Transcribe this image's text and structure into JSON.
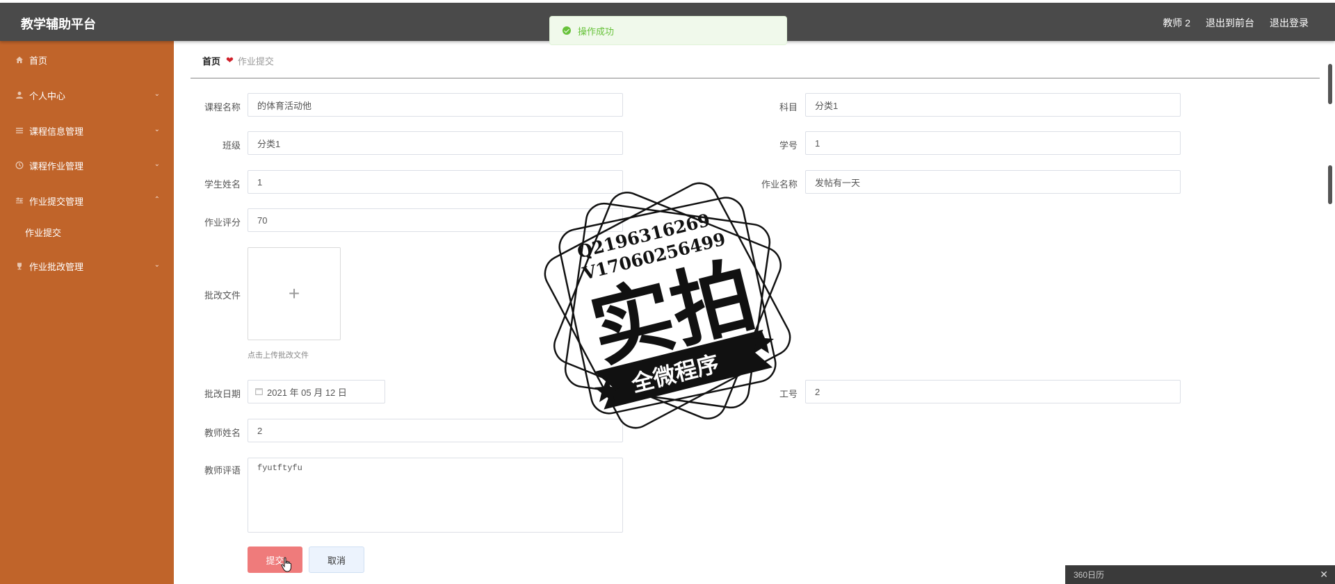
{
  "header": {
    "title": "教学辅助平台",
    "user": "教师 2",
    "to_front": "退出到前台",
    "logout": "退出登录"
  },
  "toast": {
    "message": "操作成功"
  },
  "sidebar": {
    "items": [
      {
        "label": "首页",
        "icon": "home-icon"
      },
      {
        "label": "个人中心",
        "icon": "user-icon"
      },
      {
        "label": "课程信息管理",
        "icon": "list-icon"
      },
      {
        "label": "课程作业管理",
        "icon": "clock-icon"
      },
      {
        "label": "作业提交管理",
        "icon": "sliders-icon"
      },
      {
        "label": "作业提交",
        "icon": ""
      },
      {
        "label": "作业批改管理",
        "icon": "trophy-icon"
      }
    ]
  },
  "breadcrumb": {
    "home": "首页",
    "current": "作业提交"
  },
  "form": {
    "course_name": {
      "label": "课程名称",
      "value": "的体育活动他"
    },
    "subject": {
      "label": "科目",
      "value": "分类1"
    },
    "class": {
      "label": "班级",
      "value": "分类1"
    },
    "student_no": {
      "label": "学号",
      "value": "1"
    },
    "student_name": {
      "label": "学生姓名",
      "value": "1"
    },
    "homework_name": {
      "label": "作业名称",
      "value": "发帖有一天"
    },
    "score": {
      "label": "作业评分",
      "value": "70"
    },
    "review_file": {
      "label": "批改文件",
      "tip": "点击上传批改文件"
    },
    "review_date": {
      "label": "批改日期",
      "value": "2021 年 05 月 12 日"
    },
    "teacher_no": {
      "label": "工号",
      "value": "2"
    },
    "teacher_name": {
      "label": "教师姓名",
      "value": "2"
    },
    "comment": {
      "label": "教师评语",
      "value": "fyutftyfu"
    }
  },
  "buttons": {
    "submit": "提交",
    "cancel": "取消"
  },
  "watermark": {
    "line1": "Q2196316269",
    "line2": "V17060256499",
    "main": "实拍",
    "ribbon": "全微程序"
  },
  "calendar_widget": {
    "title": "360日历"
  },
  "colors": {
    "sidebar": "#c0642a",
    "topbar": "#4a4a4a",
    "submit": "#ef7b7b",
    "success": "#67c23a"
  }
}
